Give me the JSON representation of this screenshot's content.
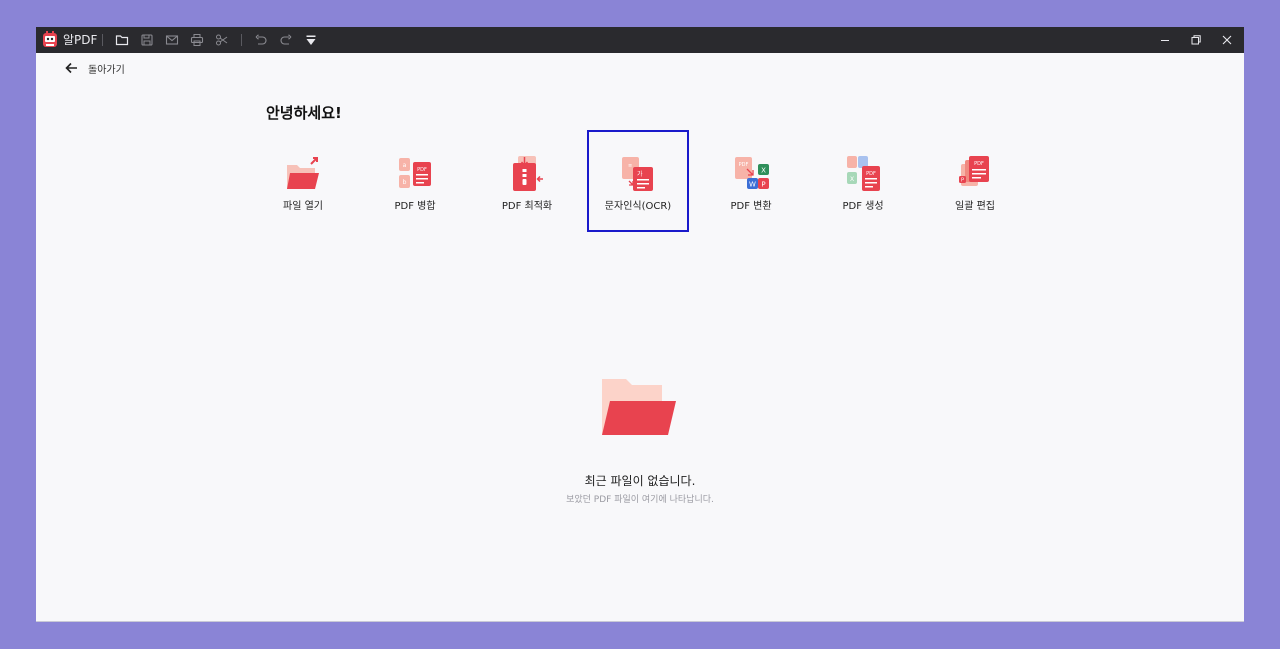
{
  "titlebar": {
    "app_name": "알PDF",
    "icons": [
      "open-folder-icon",
      "save-icon",
      "mail-icon",
      "print-icon",
      "scissors-icon",
      "undo-icon",
      "redo-icon",
      "quick-menu-icon"
    ],
    "window_controls": [
      "minimize-icon",
      "restore-icon",
      "close-icon"
    ]
  },
  "nav": {
    "back_label": "돌아가기"
  },
  "greeting": "안녕하세요!",
  "tools": [
    {
      "label": "파일 열기",
      "icon": "open-file-icon"
    },
    {
      "label": "PDF 병합",
      "icon": "merge-pdf-icon"
    },
    {
      "label": "PDF 최적화",
      "icon": "optimize-pdf-icon"
    },
    {
      "label": "문자인식(OCR)",
      "icon": "ocr-icon",
      "selected": true
    },
    {
      "label": "PDF 변환",
      "icon": "convert-pdf-icon"
    },
    {
      "label": "PDF 생성",
      "icon": "create-pdf-icon"
    },
    {
      "label": "일괄 편집",
      "icon": "batch-edit-icon"
    }
  ],
  "empty_state": {
    "title": "최근 파일이 없습니다.",
    "subtitle": "보았던 PDF 파일이 여기에 나타납니다."
  },
  "colors": {
    "accent_red": "#e8434f",
    "light_red": "#f7b3a8",
    "titlebar_bg": "#2a2a2e",
    "selection_border": "#1a1acb",
    "page_bg": "#f8f8fa"
  }
}
